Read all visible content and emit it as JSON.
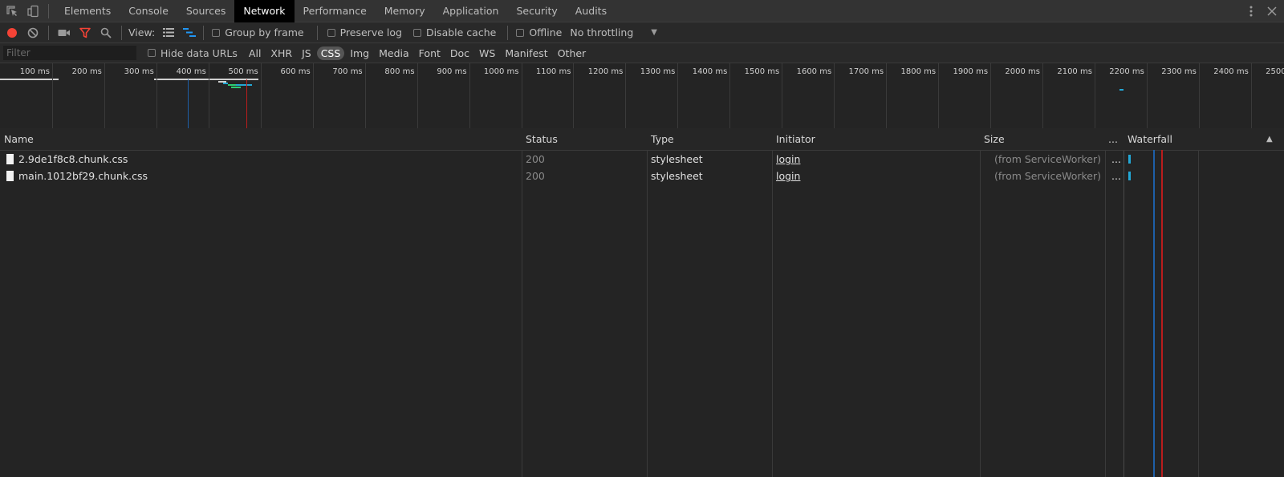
{
  "tabs": [
    {
      "label": "Elements",
      "active": false
    },
    {
      "label": "Console",
      "active": false
    },
    {
      "label": "Sources",
      "active": false
    },
    {
      "label": "Network",
      "active": true
    },
    {
      "label": "Performance",
      "active": false
    },
    {
      "label": "Memory",
      "active": false
    },
    {
      "label": "Application",
      "active": false
    },
    {
      "label": "Security",
      "active": false
    },
    {
      "label": "Audits",
      "active": false
    }
  ],
  "toolbar": {
    "view_label": "View:",
    "group_by_frame": "Group by frame",
    "preserve_log": "Preserve log",
    "disable_cache": "Disable cache",
    "offline": "Offline",
    "throttling": "No throttling"
  },
  "filter": {
    "placeholder": "Filter",
    "hide_data_urls": "Hide data URLs",
    "types": [
      "All",
      "XHR",
      "JS",
      "CSS",
      "Img",
      "Media",
      "Font",
      "Doc",
      "WS",
      "Manifest",
      "Other"
    ],
    "active_type": "CSS"
  },
  "overview": {
    "tick_labels": [
      "100 ms",
      "200 ms",
      "300 ms",
      "400 ms",
      "500 ms",
      "600 ms",
      "700 ms",
      "800 ms",
      "900 ms",
      "1000 ms",
      "1100 ms",
      "1200 ms",
      "1300 ms",
      "1400 ms",
      "1500 ms",
      "1600 ms",
      "1700 ms",
      "1800 ms",
      "1900 ms",
      "2000 ms",
      "2100 ms",
      "2200 ms",
      "2300 ms",
      "2400 ms",
      "2500 ms"
    ],
    "dom_content_loaded_ms": 360,
    "load_ms": 473
  },
  "table": {
    "columns": {
      "name": "Name",
      "status": "Status",
      "type": "Type",
      "initiator": "Initiator",
      "size": "Size",
      "more": "...",
      "waterfall": "Waterfall"
    },
    "rows": [
      {
        "name": "2.9de1f8c8.chunk.css",
        "status": "200",
        "type": "stylesheet",
        "initiator": "login",
        "size": "(from ServiceWorker)",
        "more": "..."
      },
      {
        "name": "main.1012bf29.chunk.css",
        "status": "200",
        "type": "stylesheet",
        "initiator": "login",
        "size": "(from ServiceWorker)",
        "more": "..."
      }
    ]
  },
  "colors": {
    "record": "#f44336",
    "filter_active": "#f44336",
    "view_active": "#2196f3",
    "dcl_line": "#1e5fa8",
    "load_line": "#b91c1c",
    "receiving": "#23a8d6"
  },
  "icons": [
    "inspect-icon",
    "device-toolbar-icon",
    "more-vert-icon",
    "close-icon",
    "record-icon",
    "clear-icon",
    "camera-icon",
    "filter-icon",
    "search-icon",
    "list-view-icon",
    "waterfall-view-icon",
    "dropdown-arrow-icon",
    "file-icon",
    "sort-ascending-icon"
  ]
}
